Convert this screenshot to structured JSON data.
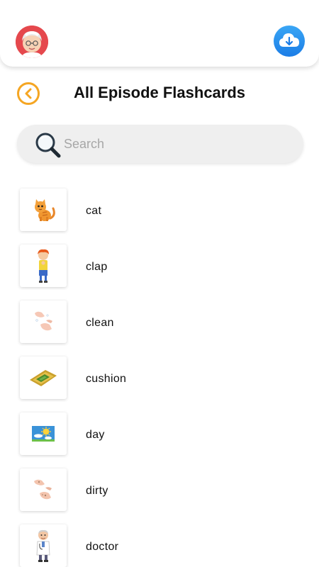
{
  "header": {
    "avatar_icon": "grandma-avatar-icon",
    "cloud_icon": "cloud-download-icon",
    "accent_color": "#f5a623",
    "cloud_color": "#1b7de6"
  },
  "page": {
    "title": "All Episode Flashcards",
    "back_icon": "chevron-left-icon"
  },
  "search": {
    "placeholder": "Search",
    "value": "",
    "icon": "magnifier-icon"
  },
  "flashcards": [
    {
      "label": "cat",
      "icon": "cat-icon"
    },
    {
      "label": "clap",
      "icon": "clapping-boy-icon"
    },
    {
      "label": "clean",
      "icon": "washing-hands-icon"
    },
    {
      "label": "cushion",
      "icon": "cushion-icon"
    },
    {
      "label": "day",
      "icon": "sun-sky-icon"
    },
    {
      "label": "dirty",
      "icon": "dirty-hands-icon"
    },
    {
      "label": "doctor",
      "icon": "doctor-icon"
    }
  ]
}
